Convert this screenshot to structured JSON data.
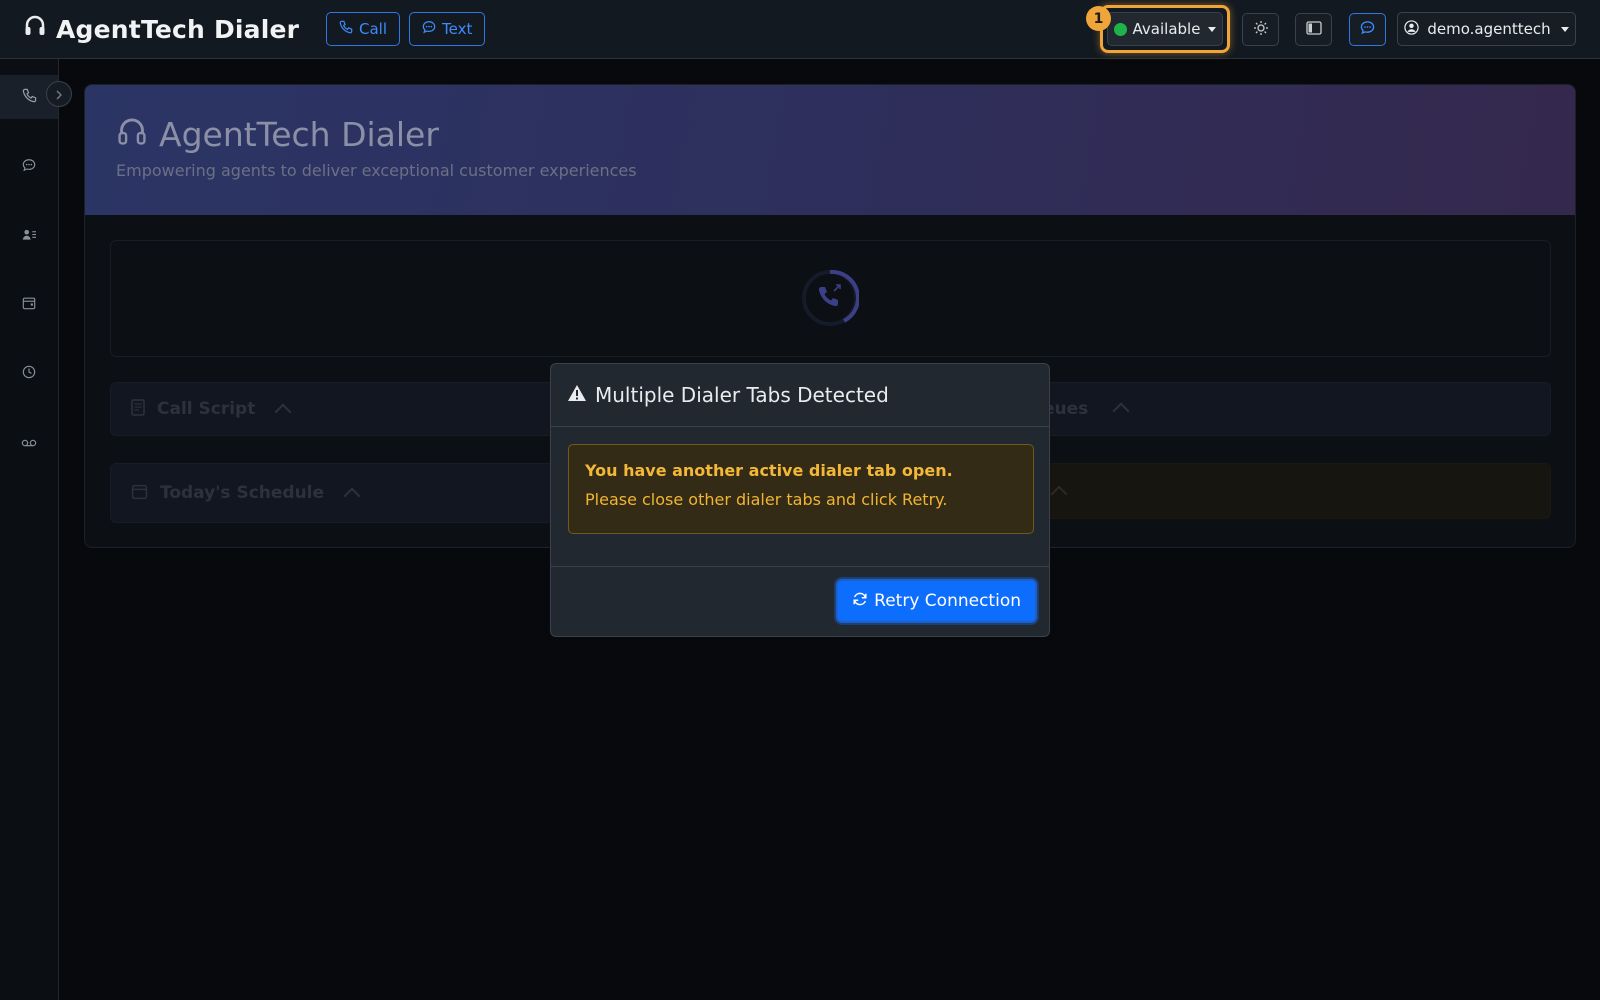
{
  "navbar": {
    "brand": "AgentTech Dialer",
    "call_label": "Call",
    "text_label": "Text",
    "status_label": "Available",
    "status_color": "#20b24a",
    "step_badge": "1",
    "username": "demo.agenttech",
    "icons": [
      "theme-sun-icon",
      "sidebar-layout-icon",
      "chat-icon"
    ]
  },
  "sidebar": {
    "items": [
      "phone-icon",
      "chat-icon",
      "contacts-icon",
      "calendar-icon",
      "history-icon",
      "voicemail-icon"
    ]
  },
  "hero": {
    "title": "AgentTech Dialer",
    "subtitle": "Empowering agents to deliver exceptional customer experiences"
  },
  "panels": {
    "call_script": "Call Script",
    "queues_partial": "eues",
    "schedule": "Today's Schedule"
  },
  "modal": {
    "title": "Multiple Dialer Tabs Detected",
    "alert_strong": "You have another active dialer tab open.",
    "alert_text": "Please close other dialer tabs and click Retry.",
    "retry_label": "Retry Connection"
  },
  "colors": {
    "accent": "#0d6efd",
    "warning": "#f3b838",
    "highlight": "#f0a53a"
  }
}
